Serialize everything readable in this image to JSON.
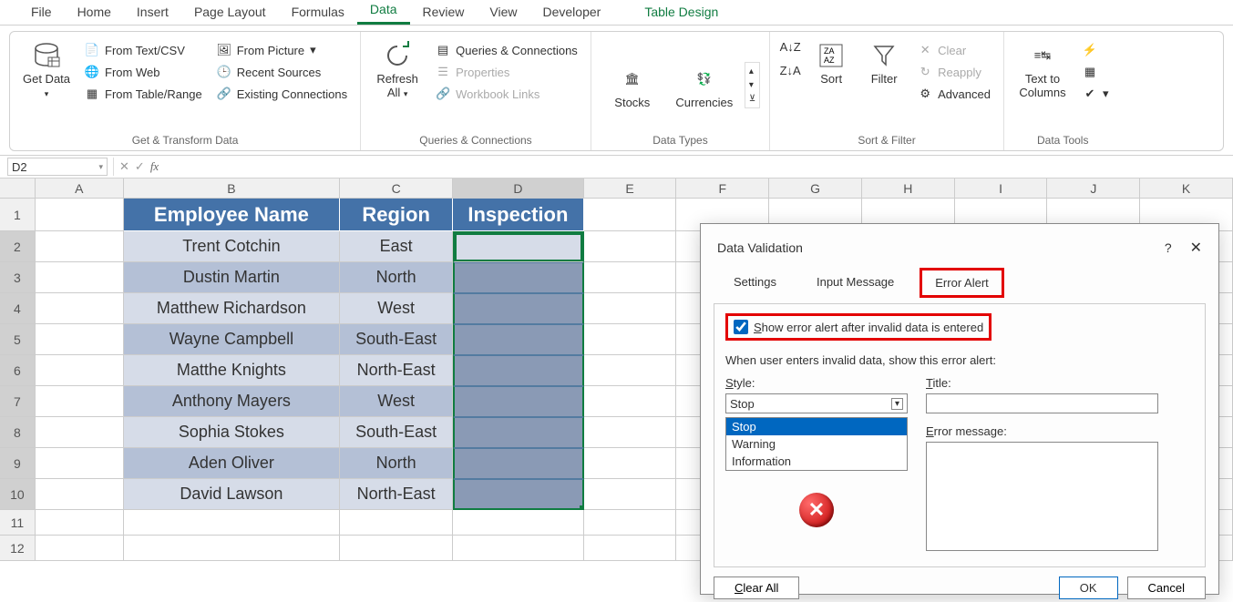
{
  "menu": {
    "tabs": [
      "File",
      "Home",
      "Insert",
      "Page Layout",
      "Formulas",
      "Data",
      "Review",
      "View",
      "Developer"
    ],
    "contextual": "Table Design",
    "active": "Data"
  },
  "ribbon": {
    "get_transform": {
      "get_data": "Get Data",
      "from_text_csv": "From Text/CSV",
      "from_web": "From Web",
      "from_table_range": "From Table/Range",
      "from_picture": "From Picture",
      "recent_sources": "Recent Sources",
      "existing_connections": "Existing Connections",
      "group_label": "Get & Transform Data"
    },
    "queries": {
      "refresh_all": "Refresh All",
      "queries_connections": "Queries & Connections",
      "properties": "Properties",
      "workbook_links": "Workbook Links",
      "group_label": "Queries & Connections"
    },
    "data_types": {
      "stocks": "Stocks",
      "currencies": "Currencies",
      "group_label": "Data Types"
    },
    "sort_filter": {
      "sort": "Sort",
      "filter": "Filter",
      "clear": "Clear",
      "reapply": "Reapply",
      "advanced": "Advanced",
      "group_label": "Sort & Filter"
    },
    "data_tools": {
      "text_to_columns": "Text to Columns",
      "group_label": "Data Tools"
    }
  },
  "name_box": "D2",
  "columns": [
    "A",
    "B",
    "C",
    "D",
    "E",
    "F",
    "G",
    "H",
    "I",
    "J",
    "K"
  ],
  "table": {
    "headers": [
      "Employee Name",
      "Region",
      "Inspection"
    ],
    "rows": [
      {
        "name": "Trent Cotchin",
        "region": "East",
        "insp": ""
      },
      {
        "name": "Dustin Martin",
        "region": "North",
        "insp": ""
      },
      {
        "name": "Matthew Richardson",
        "region": "West",
        "insp": ""
      },
      {
        "name": "Wayne Campbell",
        "region": "South-East",
        "insp": ""
      },
      {
        "name": "Matthe Knights",
        "region": "North-East",
        "insp": ""
      },
      {
        "name": "Anthony Mayers",
        "region": "West",
        "insp": ""
      },
      {
        "name": "Sophia Stokes",
        "region": "South-East",
        "insp": ""
      },
      {
        "name": "Aden Oliver",
        "region": "North",
        "insp": ""
      },
      {
        "name": "David Lawson",
        "region": "North-East",
        "insp": ""
      }
    ]
  },
  "row_numbers": [
    1,
    2,
    3,
    4,
    5,
    6,
    7,
    8,
    9,
    10,
    11,
    12
  ],
  "dialog": {
    "title": "Data Validation",
    "tabs": {
      "settings": "Settings",
      "input_message": "Input Message",
      "error_alert": "Error Alert"
    },
    "show_alert_label": "Show error alert after invalid data is entered",
    "when_label": "When user enters invalid data, show this error alert:",
    "style_label": "Style:",
    "title_label": "Title:",
    "error_msg_label": "Error message:",
    "style_value": "Stop",
    "style_options": [
      "Stop",
      "Warning",
      "Information"
    ],
    "title_value": "",
    "error_msg_value": "",
    "clear_all": "Clear All",
    "ok": "OK",
    "cancel": "Cancel"
  }
}
